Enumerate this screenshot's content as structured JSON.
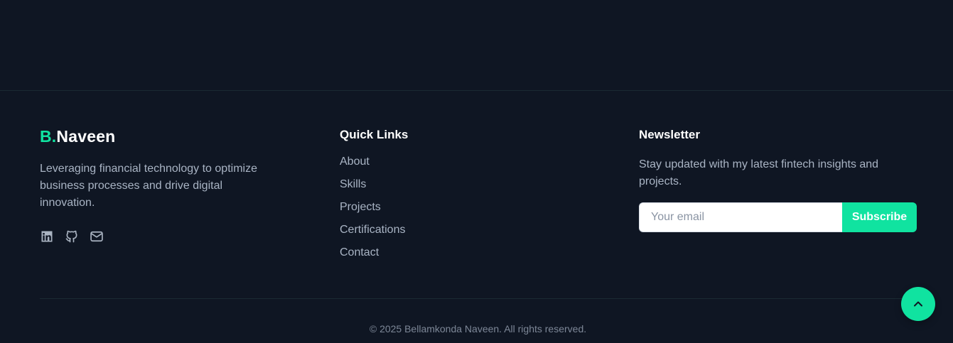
{
  "brand": {
    "logo_mark": "B.",
    "logo_name": "Naveen",
    "description": "Leveraging financial technology to optimize business processes and drive digital innovation.",
    "socials": [
      {
        "icon": "linkedin-icon"
      },
      {
        "icon": "github-icon"
      },
      {
        "icon": "mail-icon"
      }
    ]
  },
  "quick_links": {
    "title": "Quick Links",
    "items": [
      "About",
      "Skills",
      "Projects",
      "Certifications",
      "Contact"
    ]
  },
  "newsletter": {
    "title": "Newsletter",
    "description": "Stay updated with my latest fintech insights and projects.",
    "email_placeholder": "Your email",
    "email_value": "",
    "subscribe_label": "Subscribe"
  },
  "footer": {
    "copyright": "© 2025 Bellamkonda Naveen. All rights reserved."
  },
  "scroll_top": {
    "icon": "chevron-up-icon"
  },
  "colors": {
    "background": "#0f1623",
    "accent": "#10e3a0",
    "text_muted": "#a9b4c4",
    "divider": "#1b2a33"
  }
}
